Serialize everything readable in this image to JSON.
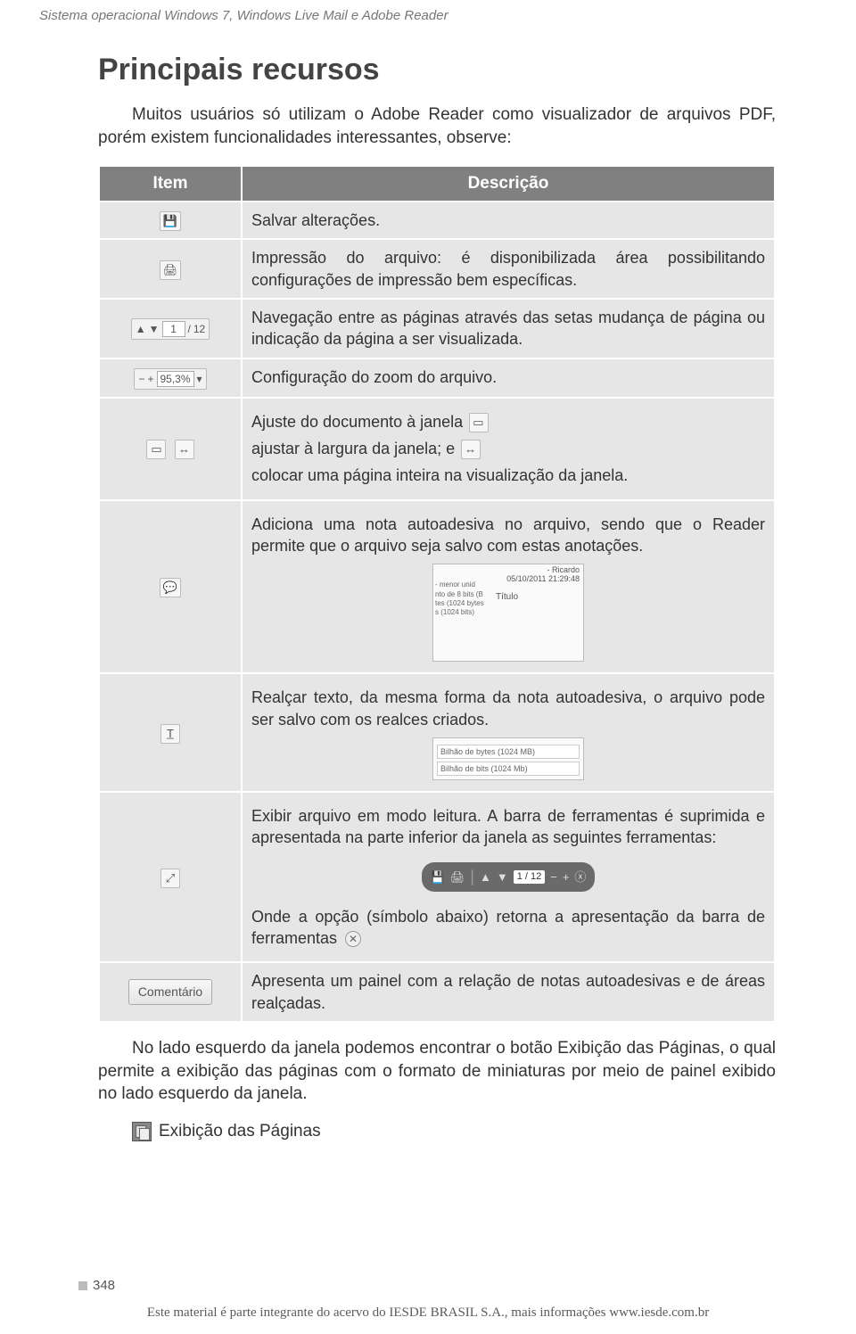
{
  "header": "Sistema operacional Windows 7, Windows Live Mail e Adobe Reader",
  "title": "Principais recursos",
  "intro": "Muitos usuários só utilizam o Adobe Reader como visualizador de arquivos PDF, porém existem funcionalidades interessantes, observe:",
  "table": {
    "head_item": "Item",
    "head_desc": "Descrição",
    "rows": {
      "save": "Salvar alterações.",
      "print": "Impressão do arquivo: é disponibilizada área possibilitando configurações de impressão bem específicas.",
      "nav": "Navegação entre as páginas através das setas mudança de página ou indicação da página a ser visualizada.",
      "zoom": "Configuração do zoom do arquivo.",
      "fit_a": "Ajuste do documento à janela",
      "fit_b": " ajustar à largura da janela; e",
      "fit_c": " colocar uma página inteira na visualização da janela.",
      "sticky": "Adiciona uma nota autoadesiva no arquivo, sendo que o Reader permite que o arquivo seja salvo com estas anotações.",
      "highlight": "Realçar texto, da mesma forma da nota autoadesiva, o arquivo pode ser salvo com os realces criados.",
      "reading_a": "Exibir arquivo em modo leitura. A barra de ferramentas é suprimida e apresentada na parte inferior da janela as seguintes ferramentas:",
      "reading_b": "Onde a opção (símbolo abaixo) retorna a apresentação da barra de ferramentas",
      "comment": "Apresenta um painel com a relação de notas autoadesivas e de áreas realçadas."
    },
    "icons": {
      "nav_page": "1",
      "nav_sep": "/",
      "nav_total": "12",
      "zoom_val": "95,3%",
      "comentario": "Comentário"
    },
    "sticky_preview": {
      "author": "- Ricardo",
      "date": "05/10/2011 21:29:48",
      "titulo": "Título",
      "l1": "- menor unid",
      "l2": "nto de 8 bits (B",
      "l3": "tes (1024 bytes",
      "l4": "s (1024 bits)"
    },
    "highlight_preview": {
      "l1": "Bilhão de bytes (1024 MB)",
      "l2": "Bilhão de bits (1024 Mb)"
    },
    "toolbar_page": "1 / 12"
  },
  "body_after": "No lado esquerdo da janela podemos encontrar o botão Exibição das Páginas, o qual permite a exibição das páginas com o formato de miniaturas por meio de painel exibido no lado esquerdo da janela.",
  "exib_label": "Exibição das Páginas",
  "page_number": "348",
  "footer": "Este material é parte integrante do acervo do IESDE BRASIL S.A., mais informações www.iesde.com.br"
}
